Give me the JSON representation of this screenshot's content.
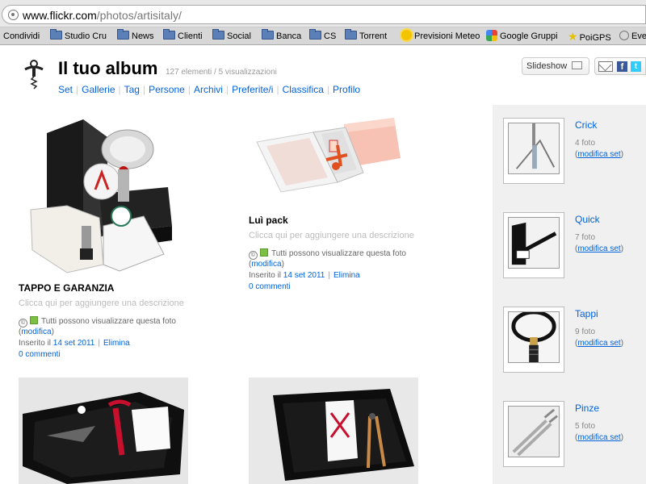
{
  "browser": {
    "url_host": "www.flickr.com",
    "url_path": "/photos/artisitaly/",
    "bookmarks": [
      {
        "label": "Condividi",
        "icon": "none"
      },
      {
        "label": "Studio Cru",
        "icon": "folder-icon"
      },
      {
        "label": "News",
        "icon": "folder-icon"
      },
      {
        "label": "Clienti",
        "icon": "folder-icon"
      },
      {
        "label": "Social",
        "icon": "folder-icon"
      },
      {
        "label": "Banca",
        "icon": "folder-icon"
      },
      {
        "label": "CS",
        "icon": "folder-icon"
      },
      {
        "label": "Torrent",
        "icon": "folder-icon"
      },
      {
        "label": "Previsioni Meteo",
        "icon": "sun-icon"
      },
      {
        "label": "Google Gruppi",
        "icon": "google-icon"
      },
      {
        "label": "PoiGPS",
        "icon": "star-icon"
      },
      {
        "label": "Eve",
        "icon": "globe-icon"
      }
    ]
  },
  "header": {
    "title": "Il tuo album",
    "stats": "127 elementi / 5 visualizzazioni",
    "nav": [
      "Set",
      "Gallerie",
      "Tag",
      "Persone",
      "Archivi",
      "Preferite/i",
      "Classifica",
      "Profilo"
    ],
    "slideshow_label": "Slideshow",
    "facebook_glyph": "f",
    "twitter_glyph": "t"
  },
  "photos": [
    {
      "title": "TAPPO E GARANZIA",
      "description_placeholder": "Clicca qui per aggiungere una descrizione",
      "cc_glyph": "©",
      "permission": "Tutti possono visualizzare questa foto",
      "edit_label": "modifica",
      "inserted_prefix": "Inserito il",
      "date": "14 set 2011",
      "delete_label": "Elimina",
      "comments": "0 commenti"
    },
    {
      "title": "Luì pack",
      "description_placeholder": "Clicca qui per aggiungere una descrizione",
      "cc_glyph": "©",
      "permission": "Tutti possono visualizzare questa foto",
      "edit_label": "modifica",
      "inserted_prefix": "Inserito il",
      "date": "14 set 2011",
      "delete_label": "Elimina",
      "comments": "0 commenti"
    }
  ],
  "sets": [
    {
      "name": "Crick",
      "count": "4 foto",
      "edit_label": "modifica set"
    },
    {
      "name": "Quick",
      "count": "7 foto",
      "edit_label": "modifica set"
    },
    {
      "name": "Tappi",
      "count": "9 foto",
      "edit_label": "modifica set"
    },
    {
      "name": "Pinze",
      "count": "5 foto",
      "edit_label": "modifica set"
    }
  ]
}
